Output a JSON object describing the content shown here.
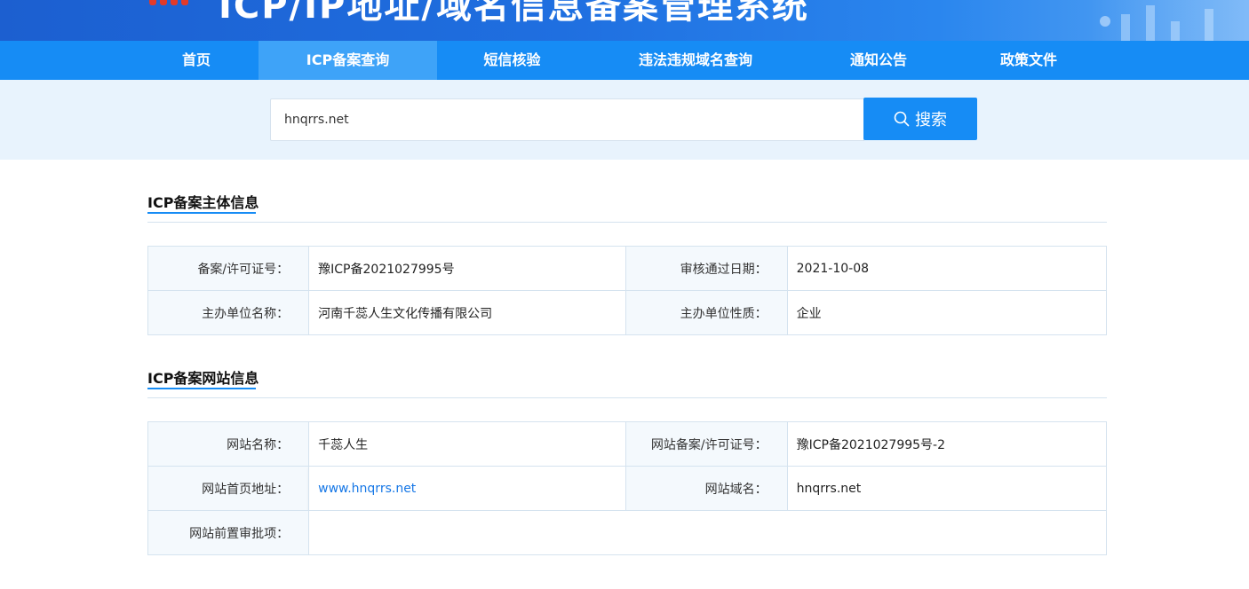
{
  "banner": {
    "title": "ICP/IP地址/域名信息备案管理系统"
  },
  "nav": {
    "items": [
      {
        "label": "首页"
      },
      {
        "label": "ICP备案查询"
      },
      {
        "label": "短信核验"
      },
      {
        "label": "违法违规域名查询"
      },
      {
        "label": "通知公告"
      },
      {
        "label": "政策文件"
      }
    ],
    "active_index": 1
  },
  "search": {
    "value": "hnqrrs.net",
    "button_label": "搜索",
    "icon": "search-icon"
  },
  "subject_section": {
    "title": "ICP备案主体信息",
    "rows": [
      [
        {
          "label": "备案/许可证号：",
          "value": "豫ICP备2021027995号"
        },
        {
          "label": "审核通过日期：",
          "value": "2021-10-08"
        }
      ],
      [
        {
          "label": "主办单位名称：",
          "value": "河南千蕊人生文化传播有限公司"
        },
        {
          "label": "主办单位性质：",
          "value": "企业"
        }
      ]
    ]
  },
  "site_section": {
    "title": "ICP备案网站信息",
    "rows": [
      [
        {
          "label": "网站名称：",
          "value": "千蕊人生"
        },
        {
          "label": "网站备案/许可证号：",
          "value": "豫ICP备2021027995号-2"
        }
      ],
      [
        {
          "label": "网站首页地址：",
          "value": "www.hnqrrs.net"
        },
        {
          "label": "网站域名：",
          "value": "hnqrrs.net"
        }
      ],
      [
        {
          "label": "网站前置审批项：",
          "value": ""
        }
      ]
    ]
  },
  "colors": {
    "nav": "#168cf5",
    "nav_active": "#3ea3f8",
    "search_band": "#e8f3fd",
    "link": "#1677e6",
    "label_bg": "#f4f9fd"
  }
}
